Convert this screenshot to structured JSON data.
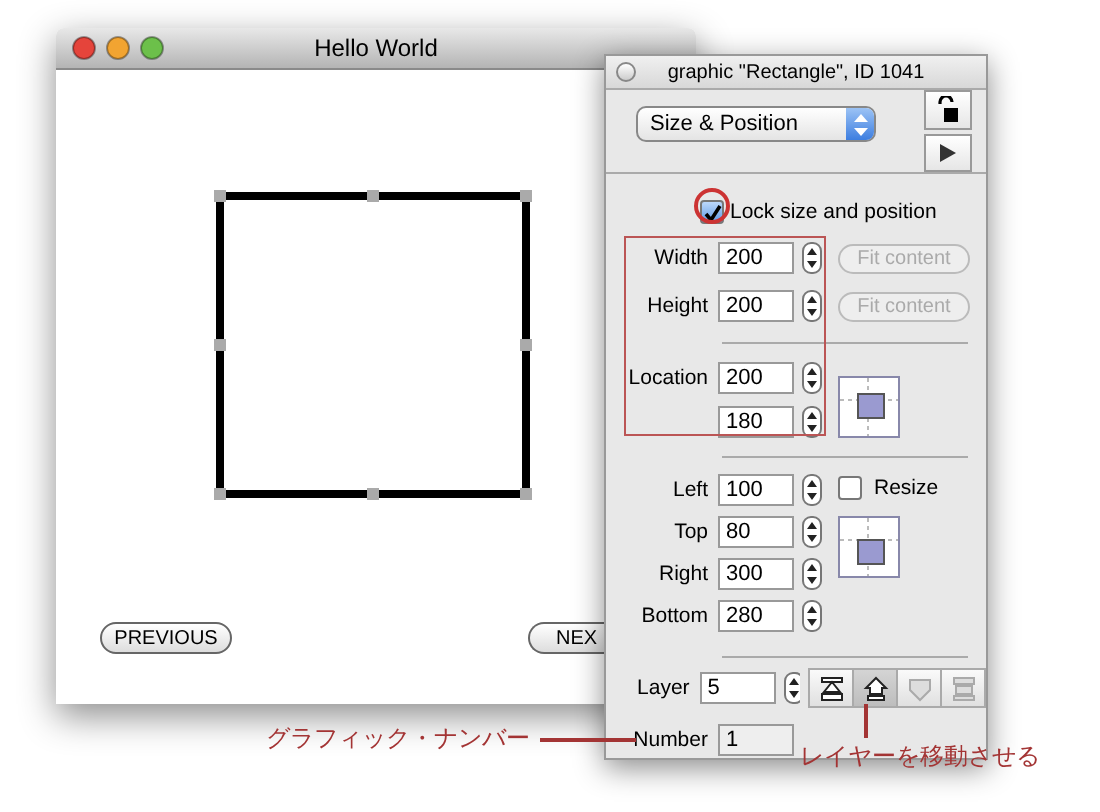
{
  "main_window": {
    "title": "Hello World",
    "buttons": [
      "PREVIOUS",
      "NEX"
    ]
  },
  "inspector": {
    "title": "graphic \"Rectangle\", ID 1041",
    "pane_menu": "Size & Position",
    "lock_size": {
      "label": "Lock size and position",
      "checked": true
    },
    "size_fields": [
      {
        "label": "Width",
        "value": "200",
        "button": {
          "label": "Fit content",
          "disabled": true
        }
      },
      {
        "label": "Height",
        "value": "200",
        "button": {
          "label": "Fit content",
          "disabled": true
        }
      }
    ],
    "location_fields": [
      {
        "label": "Location",
        "value": "200"
      },
      {
        "value": "180"
      }
    ],
    "bounds_fields": [
      {
        "label": "Left",
        "value": "100"
      },
      {
        "label": "Top",
        "value": "80"
      },
      {
        "label": "Right",
        "value": "300"
      },
      {
        "label": "Bottom",
        "value": "280"
      }
    ],
    "resize": {
      "label": "Resize",
      "checked": false
    },
    "layer": {
      "label": "Layer",
      "value": "5",
      "buttons": [
        {
          "kind": "to-front",
          "disabled": false,
          "pressed": false
        },
        {
          "kind": "forward",
          "disabled": false,
          "pressed": true
        },
        {
          "kind": "backward",
          "disabled": true,
          "pressed": false
        },
        {
          "kind": "to-back",
          "disabled": true,
          "pressed": false
        }
      ]
    },
    "number": {
      "label": "Number",
      "value": "1"
    }
  },
  "annotations": [
    {
      "kind": "left-callout",
      "text": "グラフィック・ナンバー"
    },
    {
      "kind": "below-callout",
      "text": "レイヤーを移動させる"
    }
  ]
}
